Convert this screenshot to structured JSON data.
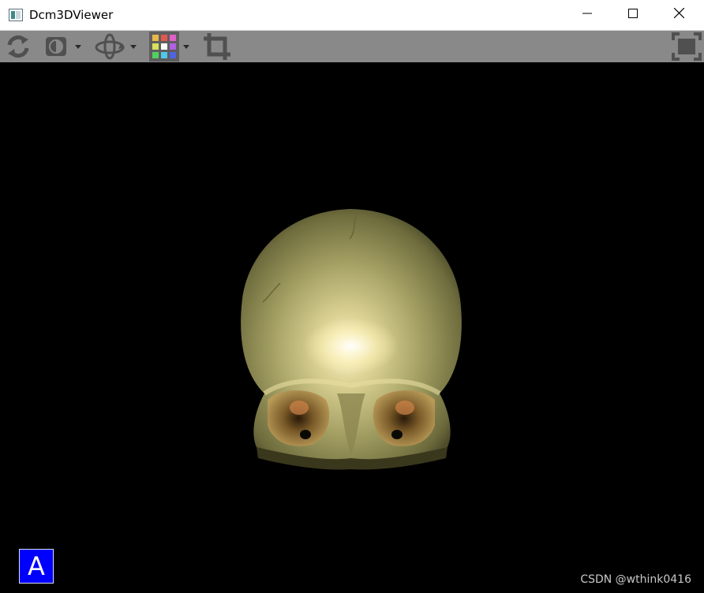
{
  "window": {
    "title": "Dcm3DViewer",
    "controls": {
      "minimize": "minimize-icon",
      "maximize": "maximize-icon",
      "close": "close-icon"
    }
  },
  "toolbar": {
    "background": "#898989",
    "tools": [
      {
        "name": "refresh",
        "icon": "refresh-icon",
        "has_dropdown": false
      },
      {
        "name": "window-level",
        "icon": "contrast-icon",
        "has_dropdown": true
      },
      {
        "name": "rotate-3d",
        "icon": "rotate-3d-icon",
        "has_dropdown": true
      },
      {
        "name": "color-preset",
        "icon": "color-grid-icon",
        "has_dropdown": true,
        "active": true
      },
      {
        "name": "crop",
        "icon": "crop-icon",
        "has_dropdown": false
      },
      {
        "name": "fullscreen",
        "icon": "fullscreen-icon",
        "has_dropdown": false
      }
    ]
  },
  "viewport": {
    "background": "#000000",
    "render": "skull-volume-render",
    "orientation_label": "A",
    "orientation_color": "#0000ff"
  },
  "watermark": "CSDN @wthink0416"
}
